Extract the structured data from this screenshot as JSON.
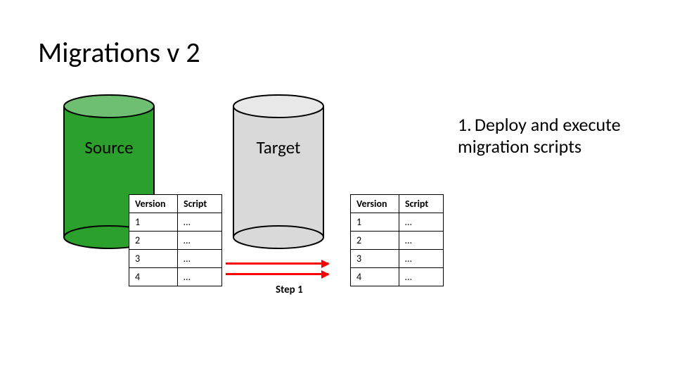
{
  "title": "Migrations v 2",
  "source": {
    "label": "Source"
  },
  "target": {
    "label": "Target"
  },
  "table_source": {
    "headers": {
      "version": "Version",
      "script": "Script"
    },
    "rows": [
      {
        "version": "1",
        "script": "…"
      },
      {
        "version": "2",
        "script": "…"
      },
      {
        "version": "3",
        "script": "…"
      },
      {
        "version": "4",
        "script": "…"
      }
    ]
  },
  "table_target": {
    "headers": {
      "version": "Version",
      "script": "Script"
    },
    "rows": [
      {
        "version": "1",
        "script": "…"
      },
      {
        "version": "2",
        "script": "…"
      },
      {
        "version": "3",
        "script": "…"
      },
      {
        "version": "4",
        "script": "…"
      }
    ]
  },
  "step1_arrow_label": "Step 1",
  "step_text": {
    "num": "1.",
    "body": "Deploy and execute migration scripts"
  }
}
